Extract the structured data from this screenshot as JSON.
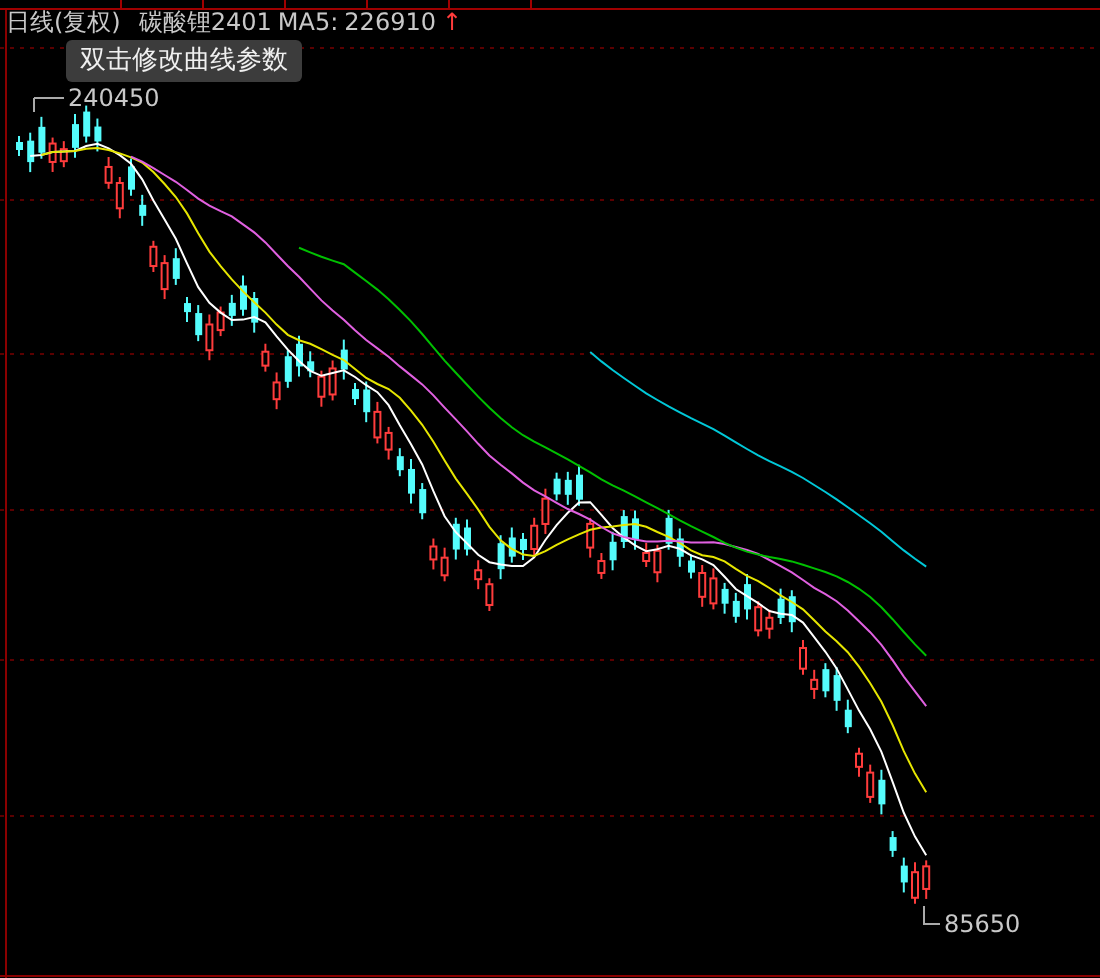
{
  "header": {
    "period": "日线(复权)",
    "symbol": "碳酸锂2401",
    "ma_label": "MA5:",
    "ma_value": "226910",
    "trend_arrow": "↑"
  },
  "tooltip": {
    "text": "双击修改曲线参数"
  },
  "chart": {
    "high_label": "240450",
    "low_label": "85650"
  }
}
